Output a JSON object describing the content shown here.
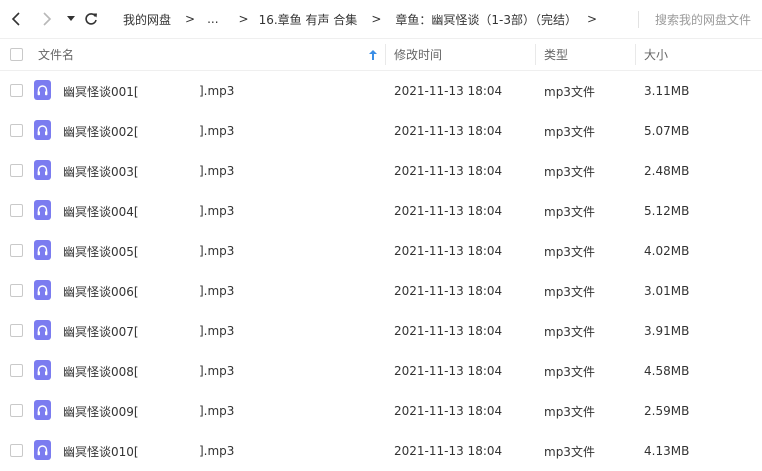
{
  "nav": {
    "back_icon": "chevron-left-icon",
    "forward_icon": "chevron-right-icon",
    "history_icon": "caret-down-icon",
    "refresh_icon": "refresh-icon"
  },
  "breadcrumb": {
    "items": [
      "我的网盘",
      "...",
      "16.章鱼 有声 合集",
      "章鱼：幽冥怪谈（1-3部）（完结）"
    ],
    "separator": ">"
  },
  "search": {
    "placeholder": "搜索我的网盘文件"
  },
  "columns": {
    "name": "文件名",
    "date": "修改时间",
    "type": "类型",
    "size": "大小",
    "sort_icon": "sort-arrow-up-icon"
  },
  "colors": {
    "icon": "#7b7cf0",
    "sort_arrow": "#3a8ee6"
  },
  "files": [
    {
      "name_a": "幽冥怪谈001[",
      "name_b": "].mp3",
      "date": "2021-11-13 18:04",
      "type": "mp3文件",
      "size": "3.11MB",
      "icon": "audio-file-icon"
    },
    {
      "name_a": "幽冥怪谈002[",
      "name_b": "].mp3",
      "date": "2021-11-13 18:04",
      "type": "mp3文件",
      "size": "5.07MB",
      "icon": "audio-file-icon"
    },
    {
      "name_a": "幽冥怪谈003[",
      "name_b": "].mp3",
      "date": "2021-11-13 18:04",
      "type": "mp3文件",
      "size": "2.48MB",
      "icon": "audio-file-icon"
    },
    {
      "name_a": "幽冥怪谈004[",
      "name_b": "].mp3",
      "date": "2021-11-13 18:04",
      "type": "mp3文件",
      "size": "5.12MB",
      "icon": "audio-file-icon"
    },
    {
      "name_a": "幽冥怪谈005[",
      "name_b": "].mp3",
      "date": "2021-11-13 18:04",
      "type": "mp3文件",
      "size": "4.02MB",
      "icon": "audio-file-icon"
    },
    {
      "name_a": "幽冥怪谈006[",
      "name_b": "].mp3",
      "date": "2021-11-13 18:04",
      "type": "mp3文件",
      "size": "3.01MB",
      "icon": "audio-file-icon"
    },
    {
      "name_a": "幽冥怪谈007[",
      "name_b": "].mp3",
      "date": "2021-11-13 18:04",
      "type": "mp3文件",
      "size": "3.91MB",
      "icon": "audio-file-icon"
    },
    {
      "name_a": "幽冥怪谈008[",
      "name_b": "].mp3",
      "date": "2021-11-13 18:04",
      "type": "mp3文件",
      "size": "4.58MB",
      "icon": "audio-file-icon"
    },
    {
      "name_a": "幽冥怪谈009[",
      "name_b": "].mp3",
      "date": "2021-11-13 18:04",
      "type": "mp3文件",
      "size": "2.59MB",
      "icon": "audio-file-icon"
    },
    {
      "name_a": "幽冥怪谈010[",
      "name_b": "].mp3",
      "date": "2021-11-13 18:04",
      "type": "mp3文件",
      "size": "4.13MB",
      "icon": "audio-file-icon"
    }
  ]
}
